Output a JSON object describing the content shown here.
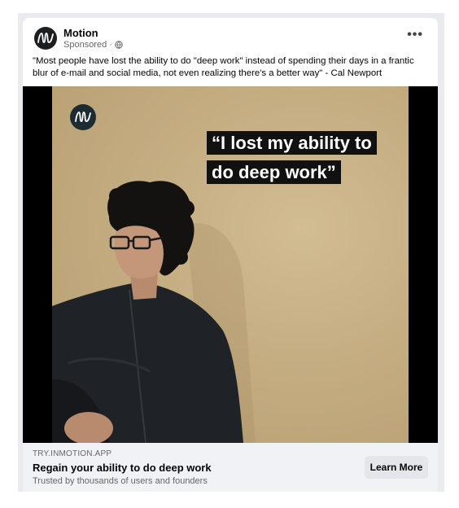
{
  "post": {
    "brand_name": "Motion",
    "sponsored_label": "Sponsored ·",
    "more_label": "•••",
    "caption": "\"Most people have lost the ability to do \"deep work\" instead of spending their days in a frantic blur of e-mail and social media, not even realizing there's a better way\" - Cal Newport"
  },
  "media": {
    "quote_line_1": "“I lost my ability to",
    "quote_line_2": "do deep work”"
  },
  "link": {
    "domain": "TRY.INMOTION.APP",
    "headline": "Regain your ability to do deep work",
    "description": "Trusted by thousands of users and founders",
    "cta_label": "Learn More"
  },
  "colors": {
    "wall": "#c8b187",
    "cta_bg": "#e4e6eb",
    "footer_bg": "#f0f2f5"
  },
  "icons": {
    "globe": "globe-icon",
    "logo": "motion-logo-icon"
  }
}
